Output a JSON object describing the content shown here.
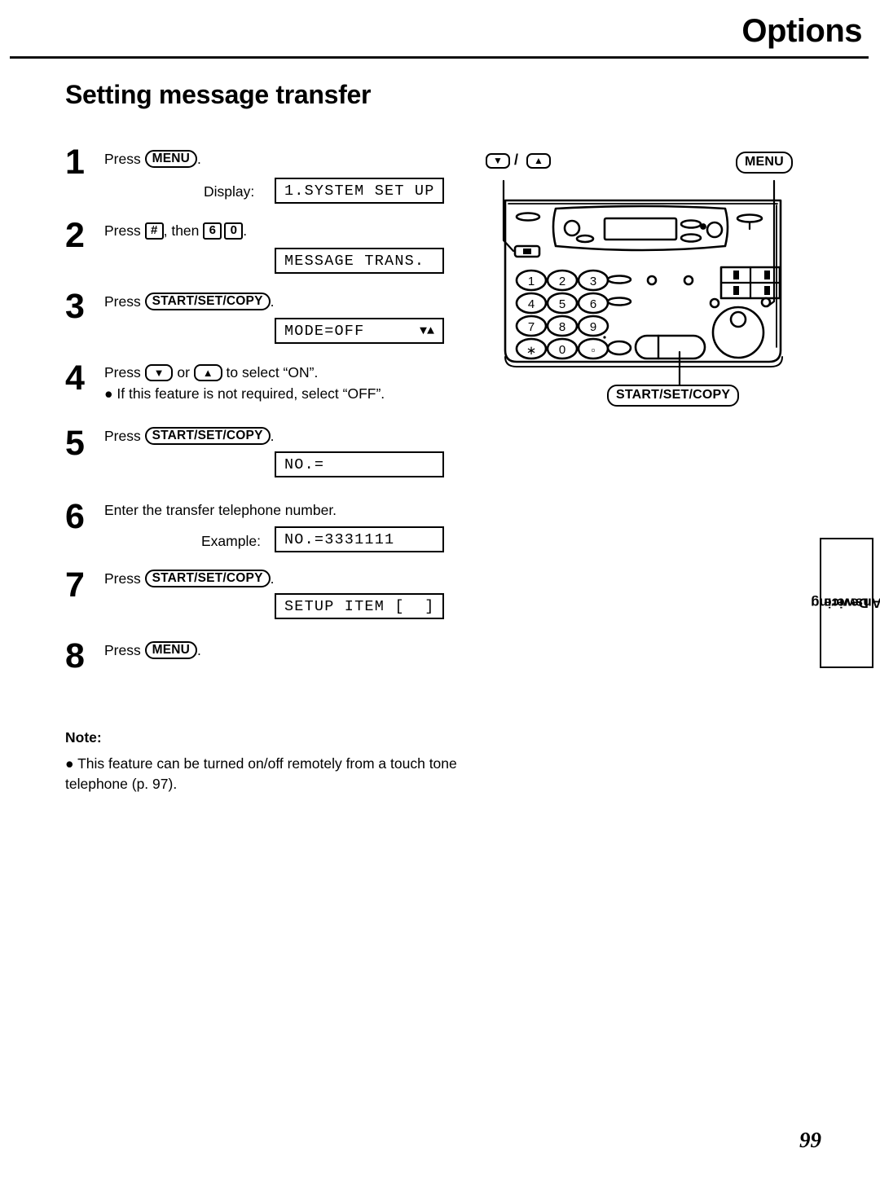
{
  "header": {
    "title": "Options",
    "section_title": "Setting message transfer"
  },
  "steps": [
    {
      "number": "1",
      "text_parts": [
        "Press ",
        "MENU",
        "."
      ],
      "key": "MENU",
      "label": "Display:",
      "display": "1.SYSTEM SET UP"
    },
    {
      "number": "2",
      "text_pre": "Press ",
      "key1": "#",
      "text_mid": ", then ",
      "key2": "6",
      "key3": "0",
      "text_post": ".",
      "display": "MESSAGE TRANS."
    },
    {
      "number": "3",
      "text_pre": "Press ",
      "key": "START/SET/COPY",
      "text_post": ".",
      "display": "MODE=OFF",
      "display_arrows": "▼▲"
    },
    {
      "number": "4",
      "text_pre": "Press ",
      "key_down": "▼",
      "text_mid": " or ",
      "key_up": "▲",
      "text_post": " to select “ON”.",
      "bullet": "● If this feature is not required, select “OFF”."
    },
    {
      "number": "5",
      "text_pre": "Press ",
      "key": "START/SET/COPY",
      "text_post": ".",
      "display": "NO.="
    },
    {
      "number": "6",
      "text": "Enter the transfer telephone number.",
      "label": "Example:",
      "display": "NO.=3331111"
    },
    {
      "number": "7",
      "text_pre": "Press ",
      "key": "START/SET/COPY",
      "text_post": ".",
      "display": "SETUP ITEM [  ]"
    },
    {
      "number": "8",
      "text_pre": "Press ",
      "key": "MENU",
      "text_post": "."
    }
  ],
  "note": {
    "heading": "Note:",
    "body": "● This feature can be turned on/off remotely from a touch tone telephone (p. 97)."
  },
  "diagram": {
    "label_arrows_sep": "/",
    "label_down": "▼",
    "label_up": "▲",
    "label_menu": "MENU",
    "label_start": "START/SET/COPY",
    "keypad": [
      "1",
      "2",
      "3",
      "4",
      "5",
      "6",
      "7",
      "8",
      "9",
      "∗",
      "0",
      "□"
    ]
  },
  "side_tab": {
    "line1": "Answering",
    "line2": "Device"
  },
  "page_number": "99"
}
